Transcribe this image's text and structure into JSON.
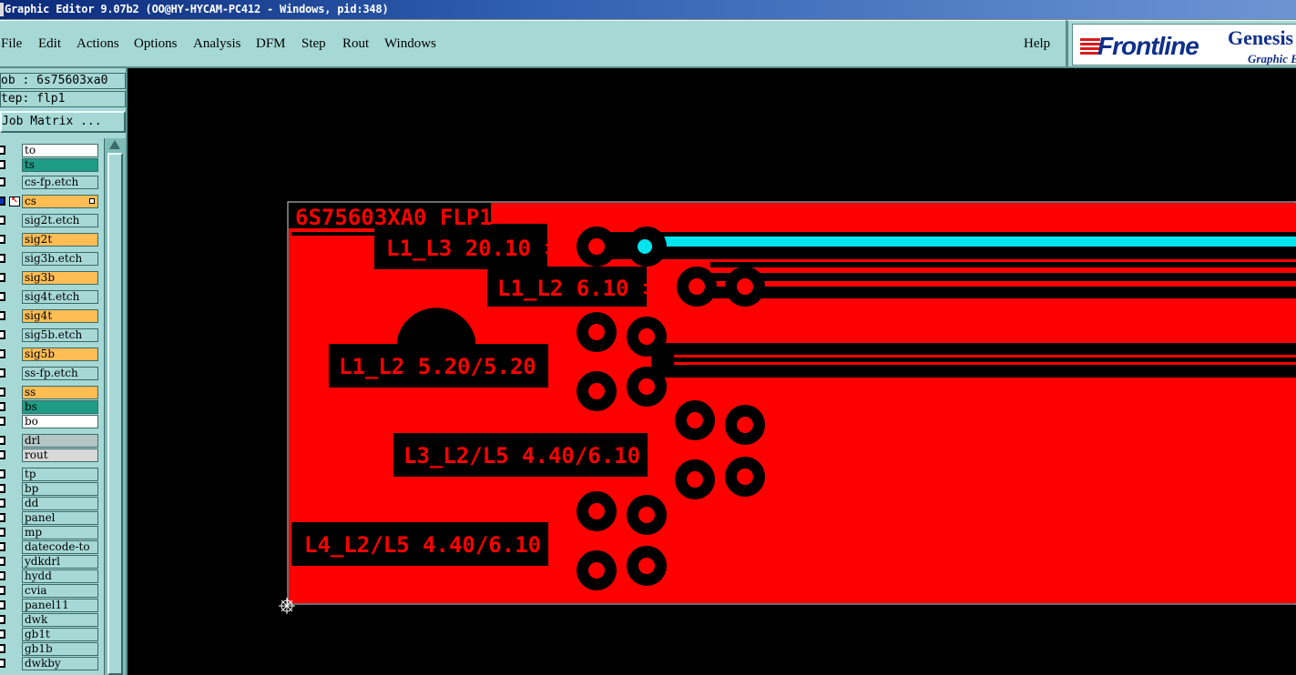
{
  "window": {
    "title": "Graphic Editor 9.07b2 (OO@HY-HYCAM-PC412 - Windows, pid:348)"
  },
  "menu": {
    "items": [
      "File",
      "Edit",
      "Actions",
      "Options",
      "Analysis",
      "DFM",
      "Step",
      "Rout",
      "Windows"
    ],
    "help": "Help"
  },
  "logo": {
    "brand": "Frontline",
    "product": "Genesis",
    "subtitle": "Graphic Editor"
  },
  "panel": {
    "job_line": "ob : 6s75603xa0",
    "step_line": "tep: flp1",
    "job_matrix": "Job Matrix ..."
  },
  "colors": {
    "ui_bg": "#a6d9d6",
    "copper": "#ff0000",
    "highlight_trace": "#00e5ee",
    "layer_orange": "#ffbd54",
    "layer_green": "#1f9c86",
    "layer_white": "#ffffff",
    "layer_gray": "#b4c6c4"
  },
  "layers": [
    {
      "name": "to",
      "color": "white"
    },
    {
      "name": "ts",
      "color": "green"
    },
    {
      "name": "cs-fp.etch",
      "color": "teal"
    },
    {
      "name": "cs",
      "color": "orange",
      "active": true
    },
    {
      "name": "sig2t.etch",
      "color": "teal"
    },
    {
      "name": "sig2t",
      "color": "orange"
    },
    {
      "name": "sig3b.etch",
      "color": "teal"
    },
    {
      "name": "sig3b",
      "color": "orange"
    },
    {
      "name": "sig4t.etch",
      "color": "teal"
    },
    {
      "name": "sig4t",
      "color": "orange"
    },
    {
      "name": "sig5b.etch",
      "color": "teal"
    },
    {
      "name": "sig5b",
      "color": "orange"
    },
    {
      "name": "ss-fp.etch",
      "color": "teal"
    },
    {
      "name": "ss",
      "color": "orange"
    },
    {
      "name": "bs",
      "color": "green"
    },
    {
      "name": "bo",
      "color": "white"
    },
    {
      "name": "drl",
      "color": "gray"
    },
    {
      "name": "rout",
      "color": "lightgray"
    },
    {
      "name": "tp",
      "color": "teal"
    },
    {
      "name": "bp",
      "color": "teal"
    },
    {
      "name": "dd",
      "color": "teal"
    },
    {
      "name": "panel",
      "color": "teal"
    },
    {
      "name": "mp",
      "color": "teal"
    },
    {
      "name": "datecode-to",
      "color": "teal"
    },
    {
      "name": "ydkdrl",
      "color": "teal"
    },
    {
      "name": "hydd",
      "color": "teal"
    },
    {
      "name": "cvia",
      "color": "teal"
    },
    {
      "name": "panel11",
      "color": "teal"
    },
    {
      "name": "dwk",
      "color": "teal"
    },
    {
      "name": "gb1t",
      "color": "teal"
    },
    {
      "name": "gb1b",
      "color": "teal"
    },
    {
      "name": "dwkby",
      "color": "teal"
    }
  ],
  "board": {
    "title_text": "6S75603XA0 FLP1",
    "labels": [
      "L1_L3 20.10 ‡",
      "L1_L2 6.10 ‡",
      "L1_L2 5.20/5.20 ‡",
      "L3_L2/L5 4.40/6.10 ‡",
      "L4_L2/L5 4.40/6.10 ‡"
    ]
  }
}
